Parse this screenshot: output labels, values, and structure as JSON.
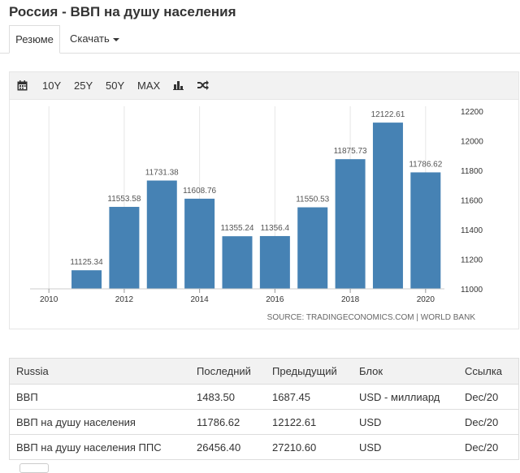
{
  "page": {
    "title": "Россия - ВВП на душу населения"
  },
  "tabs": [
    {
      "label": "Резюме"
    },
    {
      "label": "Скачать"
    }
  ],
  "toolbar": {
    "calendar_icon": "calendar-icon",
    "ranges": [
      "10Y",
      "25Y",
      "50Y",
      "MAX"
    ],
    "bar_chart_icon": "bar-chart-icon",
    "shuffle_icon": "shuffle-icon"
  },
  "chart_data": {
    "type": "bar",
    "categories": [
      "2011",
      "2012",
      "2013",
      "2014",
      "2015",
      "2016",
      "2017",
      "2018",
      "2019",
      "2020"
    ],
    "values": [
      11125.34,
      11553.58,
      11731.38,
      11608.76,
      11355.24,
      11356.4,
      11550.53,
      11875.73,
      12122.61,
      11786.62
    ],
    "value_labels": [
      "11125.34",
      "11553.58",
      "11731.38",
      "11608.76",
      "11355.24",
      "11356.4",
      "11550.53",
      "11875.73",
      "12122.61",
      "11786.62"
    ],
    "x_tick_labels": [
      "2010",
      "2012",
      "2014",
      "2016",
      "2018",
      "2020"
    ],
    "y_ticks": [
      11000,
      11200,
      11400,
      11600,
      11800,
      12000,
      12200
    ],
    "ylim": [
      11000,
      12200
    ],
    "y_axis_side": "right",
    "bar_color": "#4682b4",
    "grid": true,
    "source": "SOURCE: TRADINGECONOMICS.COM | WORLD BANK"
  },
  "table": {
    "headers": [
      "Russia",
      "Последний",
      "Предыдущий",
      "Блок",
      "Ссылка"
    ],
    "rows": [
      [
        "ВВП",
        "1483.50",
        "1687.45",
        "USD - миллиард",
        "Dec/20"
      ],
      [
        "ВВП на душу населения",
        "11786.62",
        "12122.61",
        "USD",
        "Dec/20"
      ],
      [
        "ВВП на душу населения ППС",
        "26456.40",
        "27210.60",
        "USD",
        "Dec/20"
      ]
    ]
  }
}
